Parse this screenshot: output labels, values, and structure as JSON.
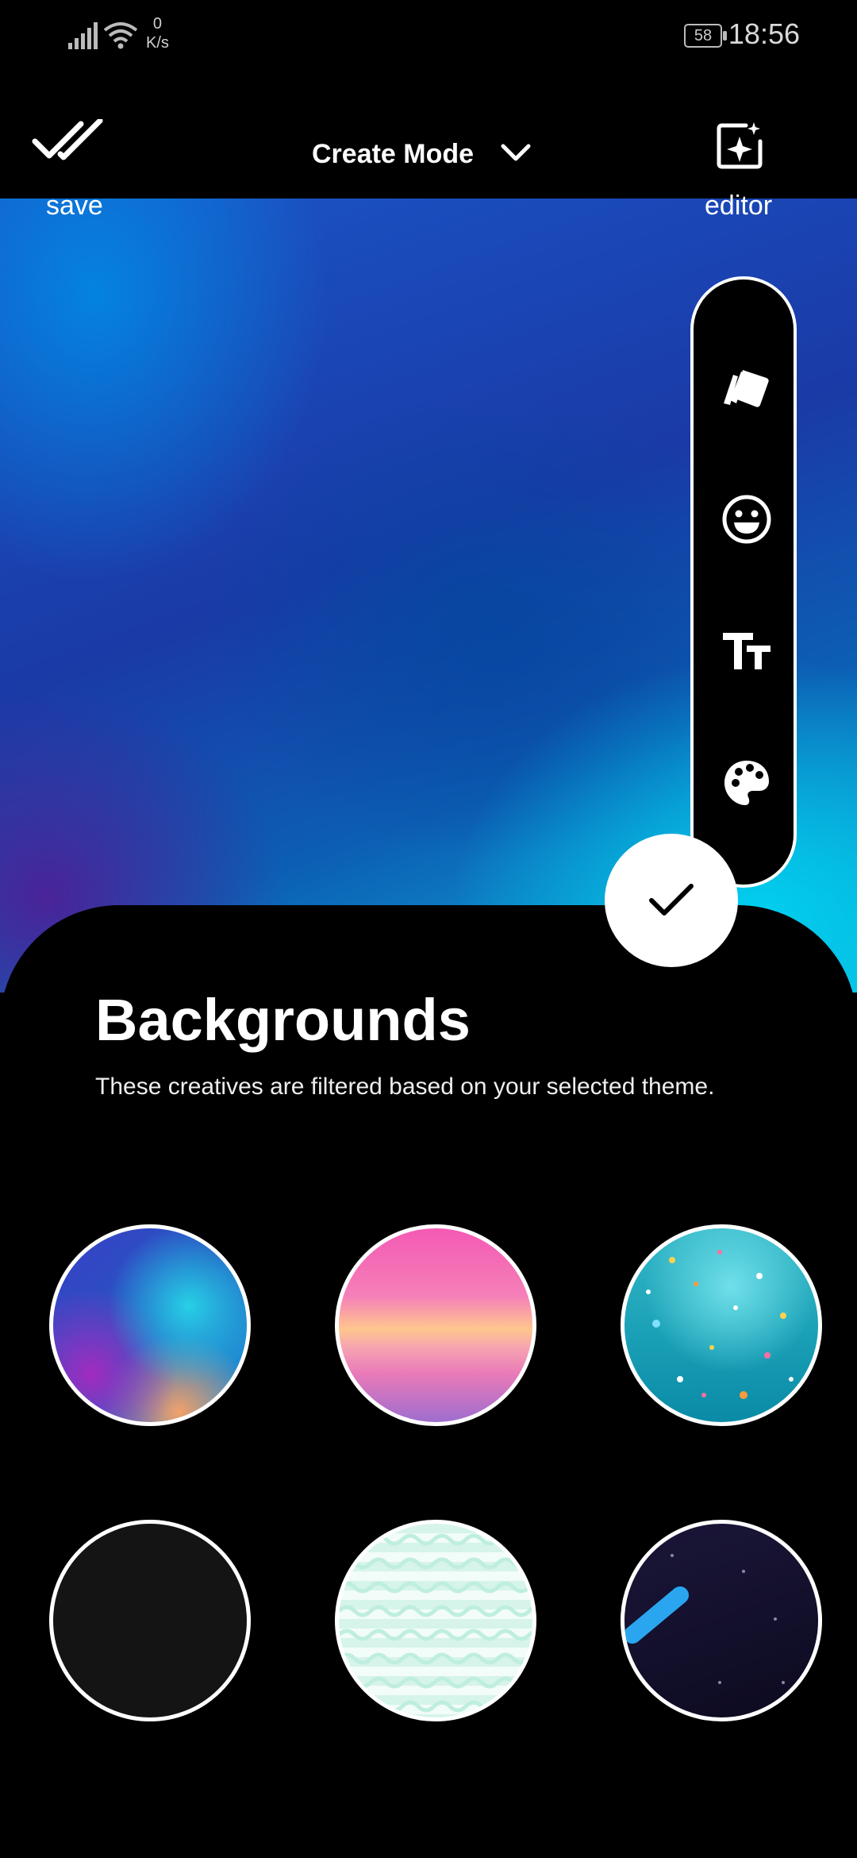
{
  "status_bar": {
    "speed_value": "0",
    "speed_unit": "K/s",
    "battery": "58",
    "time": "18:56"
  },
  "header": {
    "save_label": "save",
    "title": "Create Mode",
    "editor_label": "editor"
  },
  "toolbar": {
    "tools": [
      "cards-icon",
      "emoji-icon",
      "text-size-icon",
      "palette-icon"
    ]
  },
  "panel": {
    "title": "Backgrounds",
    "subtitle": "These creatives are filtered based on your selected theme."
  },
  "colors": {
    "background": "#000000",
    "accent": "#ffffff"
  }
}
